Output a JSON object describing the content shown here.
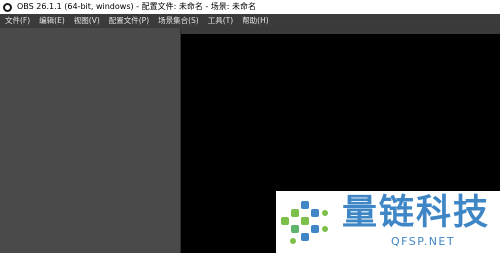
{
  "window": {
    "title": "OBS 26.1.1 (64-bit, windows) - 配置文件: 未命名 - 场景: 未命名",
    "app_icon": "obs-logo-icon"
  },
  "menubar": {
    "items": [
      {
        "label": "文件(F)"
      },
      {
        "label": "编辑(E)"
      },
      {
        "label": "视图(V)"
      },
      {
        "label": "配置文件(P)"
      },
      {
        "label": "场景集合(S)"
      },
      {
        "label": "工具(T)"
      },
      {
        "label": "帮助(H)"
      }
    ]
  },
  "watermark": {
    "name": "量链科技",
    "url": "QFSP.NET",
    "color": "#3f86c6",
    "accent_green": "#7cc04b"
  },
  "colors": {
    "panel": "#4a4a4a",
    "menubar": "#3b3b3b",
    "preview": "#000000"
  }
}
